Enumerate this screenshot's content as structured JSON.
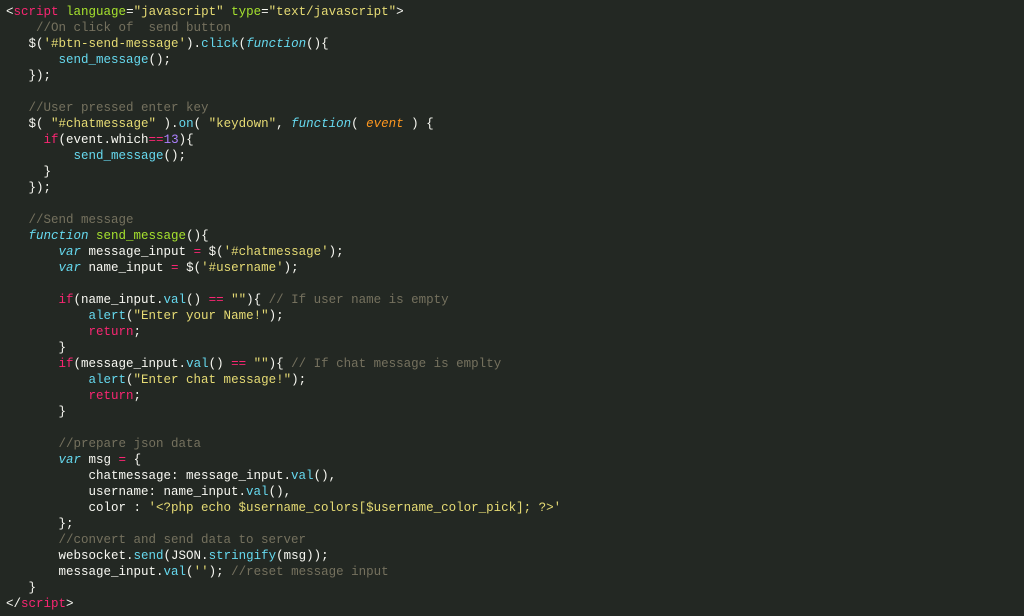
{
  "code": {
    "lines": [
      [
        {
          "c": "punct",
          "t": "<"
        },
        {
          "c": "tag",
          "t": "script"
        },
        {
          "c": "plain",
          "t": " "
        },
        {
          "c": "attr",
          "t": "language"
        },
        {
          "c": "punct",
          "t": "="
        },
        {
          "c": "string",
          "t": "\"javascript\""
        },
        {
          "c": "plain",
          "t": " "
        },
        {
          "c": "attr",
          "t": "type"
        },
        {
          "c": "punct",
          "t": "="
        },
        {
          "c": "string",
          "t": "\"text/javascript\""
        },
        {
          "c": "punct",
          "t": ">"
        }
      ],
      [
        {
          "c": "plain",
          "t": "    "
        },
        {
          "c": "comment",
          "t": "//On click of  send button"
        }
      ],
      [
        {
          "c": "plain",
          "t": "   $("
        },
        {
          "c": "string",
          "t": "'#btn-send-message'"
        },
        {
          "c": "plain",
          "t": ")."
        },
        {
          "c": "funccall",
          "t": "click"
        },
        {
          "c": "plain",
          "t": "("
        },
        {
          "c": "keyword",
          "t": "function"
        },
        {
          "c": "plain",
          "t": "(){"
        }
      ],
      [
        {
          "c": "plain",
          "t": "       "
        },
        {
          "c": "funccall",
          "t": "send_message"
        },
        {
          "c": "plain",
          "t": "();"
        }
      ],
      [
        {
          "c": "plain",
          "t": "   });"
        }
      ],
      [
        {
          "c": "plain",
          "t": ""
        }
      ],
      [
        {
          "c": "plain",
          "t": "   "
        },
        {
          "c": "comment",
          "t": "//User pressed enter key"
        }
      ],
      [
        {
          "c": "plain",
          "t": "   $( "
        },
        {
          "c": "string",
          "t": "\"#chatmessage\""
        },
        {
          "c": "plain",
          "t": " )."
        },
        {
          "c": "funccall",
          "t": "on"
        },
        {
          "c": "plain",
          "t": "( "
        },
        {
          "c": "string",
          "t": "\"keydown\""
        },
        {
          "c": "plain",
          "t": ", "
        },
        {
          "c": "keyword",
          "t": "function"
        },
        {
          "c": "plain",
          "t": "( "
        },
        {
          "c": "param",
          "t": "event"
        },
        {
          "c": "plain",
          "t": " ) {"
        }
      ],
      [
        {
          "c": "plain",
          "t": "     "
        },
        {
          "c": "keyword2",
          "t": "if"
        },
        {
          "c": "plain",
          "t": "(event.which"
        },
        {
          "c": "keyword2",
          "t": "=="
        },
        {
          "c": "number",
          "t": "13"
        },
        {
          "c": "plain",
          "t": "){"
        }
      ],
      [
        {
          "c": "plain",
          "t": "         "
        },
        {
          "c": "funccall",
          "t": "send_message"
        },
        {
          "c": "plain",
          "t": "();"
        }
      ],
      [
        {
          "c": "plain",
          "t": "     }"
        }
      ],
      [
        {
          "c": "plain",
          "t": "   });"
        }
      ],
      [
        {
          "c": "plain",
          "t": ""
        }
      ],
      [
        {
          "c": "plain",
          "t": "   "
        },
        {
          "c": "comment",
          "t": "//Send message"
        }
      ],
      [
        {
          "c": "plain",
          "t": "   "
        },
        {
          "c": "keyword",
          "t": "function"
        },
        {
          "c": "plain",
          "t": " "
        },
        {
          "c": "funcname",
          "t": "send_message"
        },
        {
          "c": "plain",
          "t": "(){"
        }
      ],
      [
        {
          "c": "plain",
          "t": "       "
        },
        {
          "c": "keyword",
          "t": "var"
        },
        {
          "c": "plain",
          "t": " message_input "
        },
        {
          "c": "keyword2",
          "t": "="
        },
        {
          "c": "plain",
          "t": " $("
        },
        {
          "c": "string",
          "t": "'#chatmessage'"
        },
        {
          "c": "plain",
          "t": ");"
        }
      ],
      [
        {
          "c": "plain",
          "t": "       "
        },
        {
          "c": "keyword",
          "t": "var"
        },
        {
          "c": "plain",
          "t": " name_input "
        },
        {
          "c": "keyword2",
          "t": "="
        },
        {
          "c": "plain",
          "t": " $("
        },
        {
          "c": "string",
          "t": "'#username'"
        },
        {
          "c": "plain",
          "t": ");"
        }
      ],
      [
        {
          "c": "plain",
          "t": ""
        }
      ],
      [
        {
          "c": "plain",
          "t": "       "
        },
        {
          "c": "keyword2",
          "t": "if"
        },
        {
          "c": "plain",
          "t": "(name_input."
        },
        {
          "c": "funccall",
          "t": "val"
        },
        {
          "c": "plain",
          "t": "() "
        },
        {
          "c": "keyword2",
          "t": "=="
        },
        {
          "c": "plain",
          "t": " "
        },
        {
          "c": "string",
          "t": "\"\""
        },
        {
          "c": "plain",
          "t": "){ "
        },
        {
          "c": "comment",
          "t": "// If user name is empty"
        }
      ],
      [
        {
          "c": "plain",
          "t": "           "
        },
        {
          "c": "funccall",
          "t": "alert"
        },
        {
          "c": "plain",
          "t": "("
        },
        {
          "c": "string",
          "t": "\"Enter your Name!\""
        },
        {
          "c": "plain",
          "t": ");"
        }
      ],
      [
        {
          "c": "plain",
          "t": "           "
        },
        {
          "c": "keyword2",
          "t": "return"
        },
        {
          "c": "plain",
          "t": ";"
        }
      ],
      [
        {
          "c": "plain",
          "t": "       }"
        }
      ],
      [
        {
          "c": "plain",
          "t": "       "
        },
        {
          "c": "keyword2",
          "t": "if"
        },
        {
          "c": "plain",
          "t": "(message_input."
        },
        {
          "c": "funccall",
          "t": "val"
        },
        {
          "c": "plain",
          "t": "() "
        },
        {
          "c": "keyword2",
          "t": "=="
        },
        {
          "c": "plain",
          "t": " "
        },
        {
          "c": "string",
          "t": "\"\""
        },
        {
          "c": "plain",
          "t": "){ "
        },
        {
          "c": "comment",
          "t": "// If chat message is emplty"
        }
      ],
      [
        {
          "c": "plain",
          "t": "           "
        },
        {
          "c": "funccall",
          "t": "alert"
        },
        {
          "c": "plain",
          "t": "("
        },
        {
          "c": "string",
          "t": "\"Enter chat message!\""
        },
        {
          "c": "plain",
          "t": ");"
        }
      ],
      [
        {
          "c": "plain",
          "t": "           "
        },
        {
          "c": "keyword2",
          "t": "return"
        },
        {
          "c": "plain",
          "t": ";"
        }
      ],
      [
        {
          "c": "plain",
          "t": "       }"
        }
      ],
      [
        {
          "c": "plain",
          "t": ""
        }
      ],
      [
        {
          "c": "plain",
          "t": "       "
        },
        {
          "c": "comment",
          "t": "//prepare json data"
        }
      ],
      [
        {
          "c": "plain",
          "t": "       "
        },
        {
          "c": "keyword",
          "t": "var"
        },
        {
          "c": "plain",
          "t": " msg "
        },
        {
          "c": "keyword2",
          "t": "="
        },
        {
          "c": "plain",
          "t": " {"
        }
      ],
      [
        {
          "c": "plain",
          "t": "           chatmessage: message_input."
        },
        {
          "c": "funccall",
          "t": "val"
        },
        {
          "c": "plain",
          "t": "(),"
        }
      ],
      [
        {
          "c": "plain",
          "t": "           username: name_input."
        },
        {
          "c": "funccall",
          "t": "val"
        },
        {
          "c": "plain",
          "t": "(),"
        }
      ],
      [
        {
          "c": "plain",
          "t": "           color : "
        },
        {
          "c": "string",
          "t": "'<?php echo $username_colors[$username_color_pick]; ?>'"
        }
      ],
      [
        {
          "c": "plain",
          "t": "       };"
        }
      ],
      [
        {
          "c": "plain",
          "t": "       "
        },
        {
          "c": "comment",
          "t": "//convert and send data to server"
        }
      ],
      [
        {
          "c": "plain",
          "t": "       websocket."
        },
        {
          "c": "funccall",
          "t": "send"
        },
        {
          "c": "plain",
          "t": "(JSON."
        },
        {
          "c": "funccall",
          "t": "stringify"
        },
        {
          "c": "plain",
          "t": "(msg));"
        }
      ],
      [
        {
          "c": "plain",
          "t": "       message_input."
        },
        {
          "c": "funccall",
          "t": "val"
        },
        {
          "c": "plain",
          "t": "("
        },
        {
          "c": "string",
          "t": "''"
        },
        {
          "c": "plain",
          "t": "); "
        },
        {
          "c": "comment",
          "t": "//reset message input"
        }
      ],
      [
        {
          "c": "plain",
          "t": "   }"
        }
      ],
      [
        {
          "c": "punct",
          "t": "</"
        },
        {
          "c": "tag",
          "t": "script"
        },
        {
          "c": "punct",
          "t": ">"
        }
      ]
    ]
  }
}
